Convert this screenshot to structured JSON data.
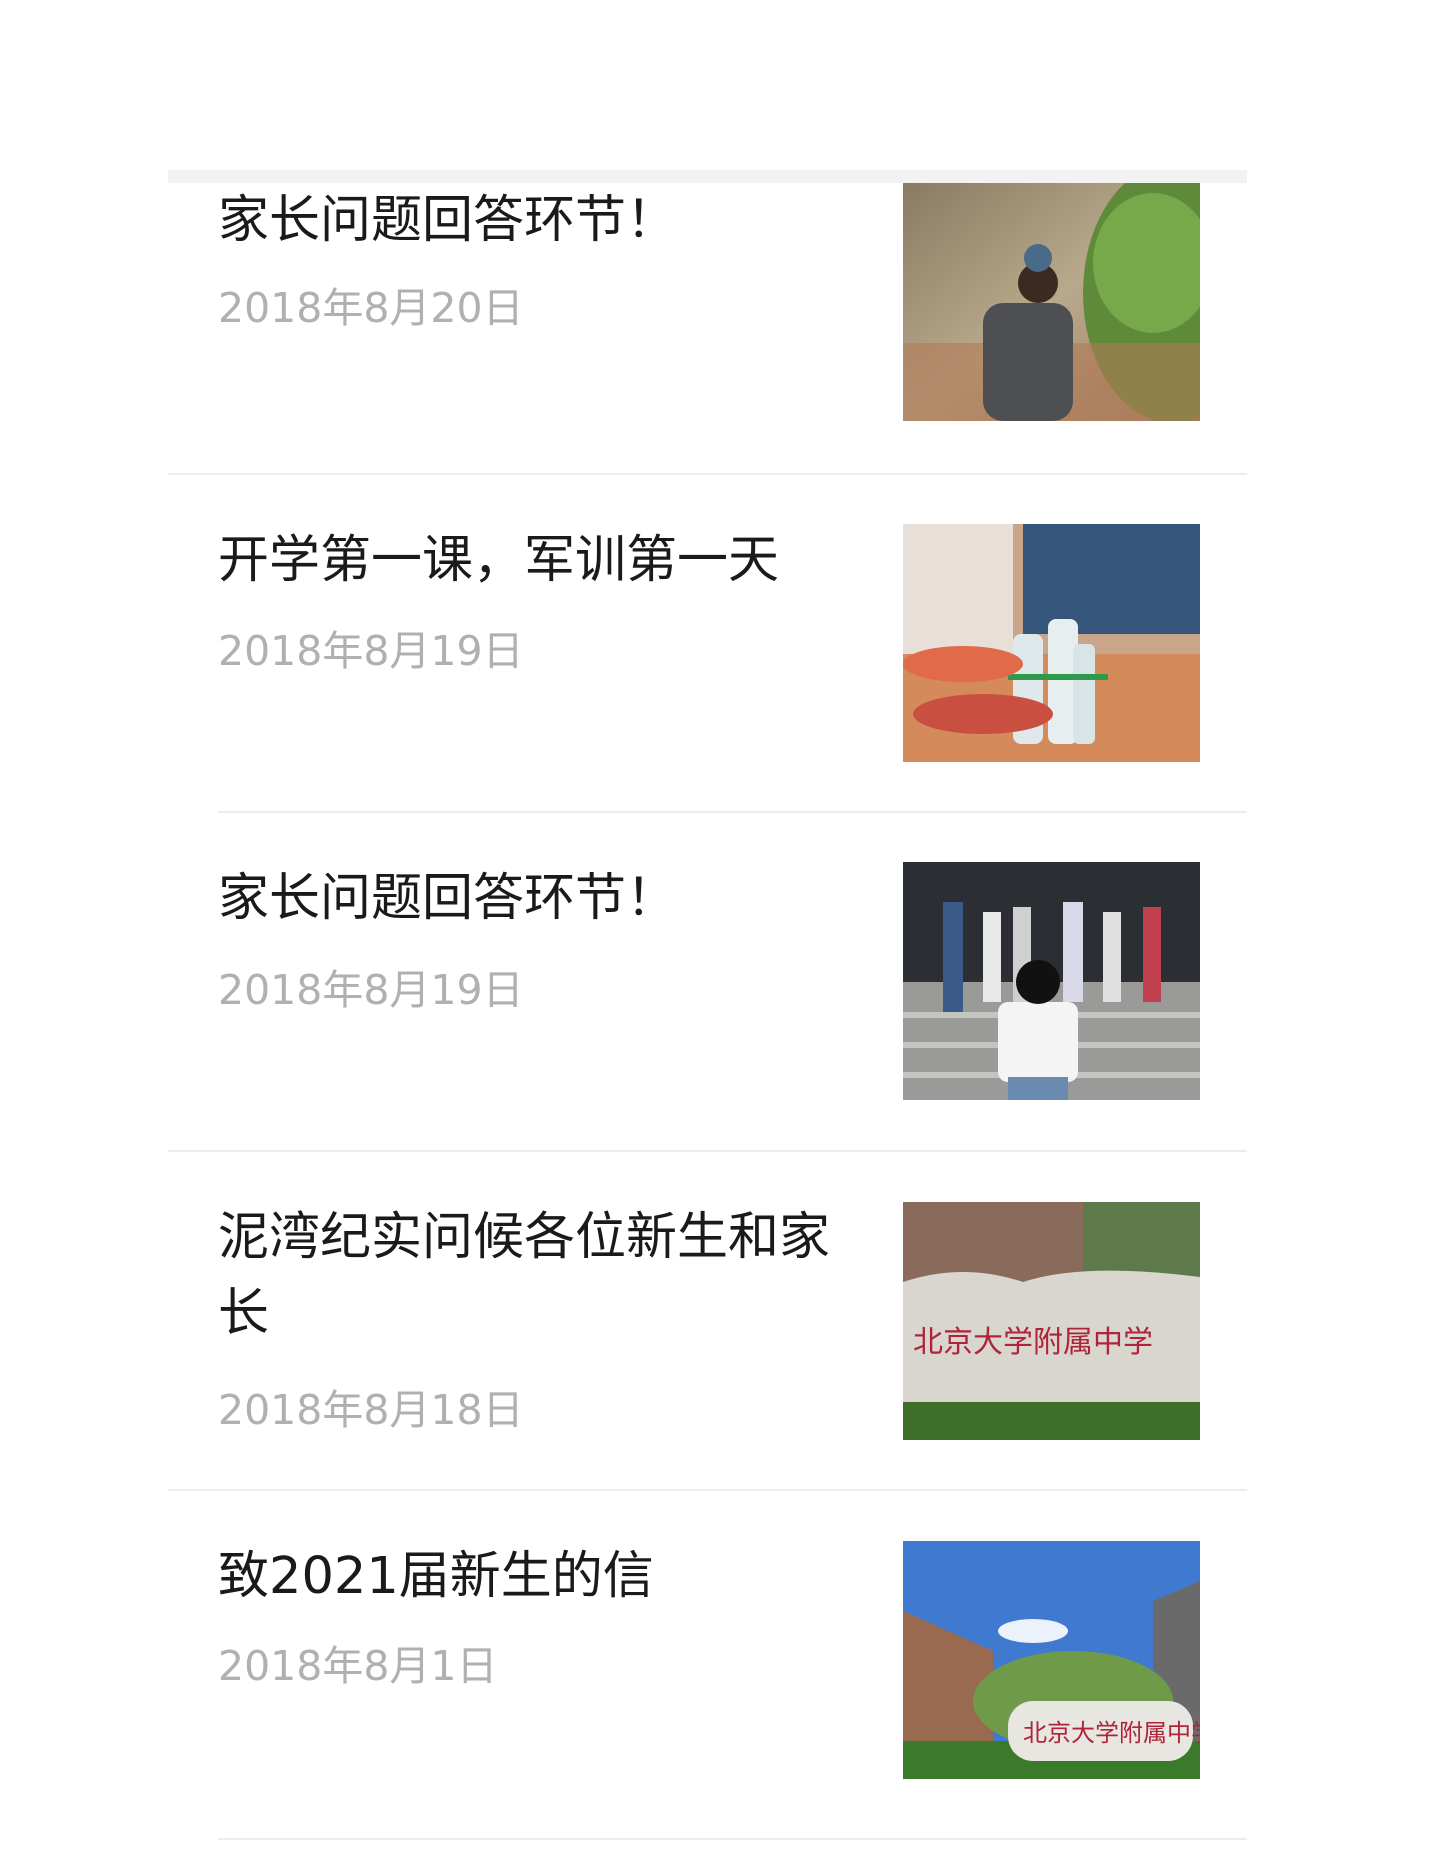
{
  "articles": [
    {
      "title": "家长问题回答环节！",
      "date": "2018年8月20日",
      "image": "student-walking-by-hedge-photo"
    },
    {
      "title": "开学第一课，军训第一天",
      "date": "2018年8月19日",
      "image": "hands-with-water-bottles-photo"
    },
    {
      "title": "家长问题回答环节！",
      "date": "2018年8月19日",
      "image": "people-on-steps-photo"
    },
    {
      "title": "泥湾纪实问候各位新生和家长",
      "date": "2018年8月18日",
      "image": "school-stone-inscription-photo"
    },
    {
      "title": "致2021届新生的信",
      "date": "2018年8月1日",
      "image": "campus-stone-blue-sky-photo"
    }
  ],
  "images": {
    "stone_inscription_text": "北京大学附属中学"
  },
  "colors": {
    "title": "#1a1a1a",
    "date": "#b0b0b0",
    "divider": "#ececec",
    "top_bar": "#f2f2f2"
  }
}
